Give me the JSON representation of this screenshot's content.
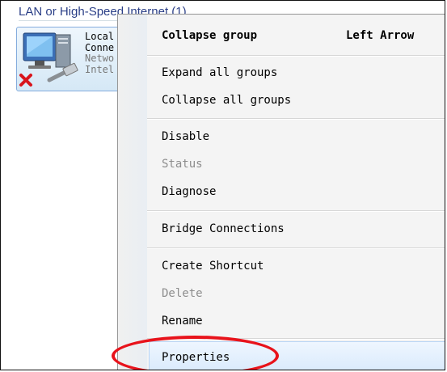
{
  "group": {
    "header": "LAN or High-Speed Internet (1)"
  },
  "connection": {
    "lines": [
      "Local",
      "Conne",
      "Netwo",
      "Intel"
    ]
  },
  "context_menu": {
    "items": [
      {
        "label": "Collapse group",
        "shortcut": "Left Arrow",
        "bold": true,
        "enabled": true
      },
      {
        "label": "Expand all groups",
        "enabled": true
      },
      {
        "label": "Collapse all groups",
        "enabled": true
      },
      {
        "label": "Disable",
        "enabled": true
      },
      {
        "label": "Status",
        "enabled": false
      },
      {
        "label": "Diagnose",
        "enabled": true
      },
      {
        "label": "Bridge Connections",
        "enabled": true
      },
      {
        "label": "Create Shortcut",
        "enabled": true
      },
      {
        "label": "Delete",
        "enabled": false
      },
      {
        "label": "Rename",
        "enabled": true
      },
      {
        "label": "Properties",
        "enabled": true,
        "highlighted": true
      }
    ]
  },
  "colors": {
    "annotation": "#e8131b",
    "group_header": "#2b3f87",
    "disabled_text": "#8d8d8d"
  }
}
